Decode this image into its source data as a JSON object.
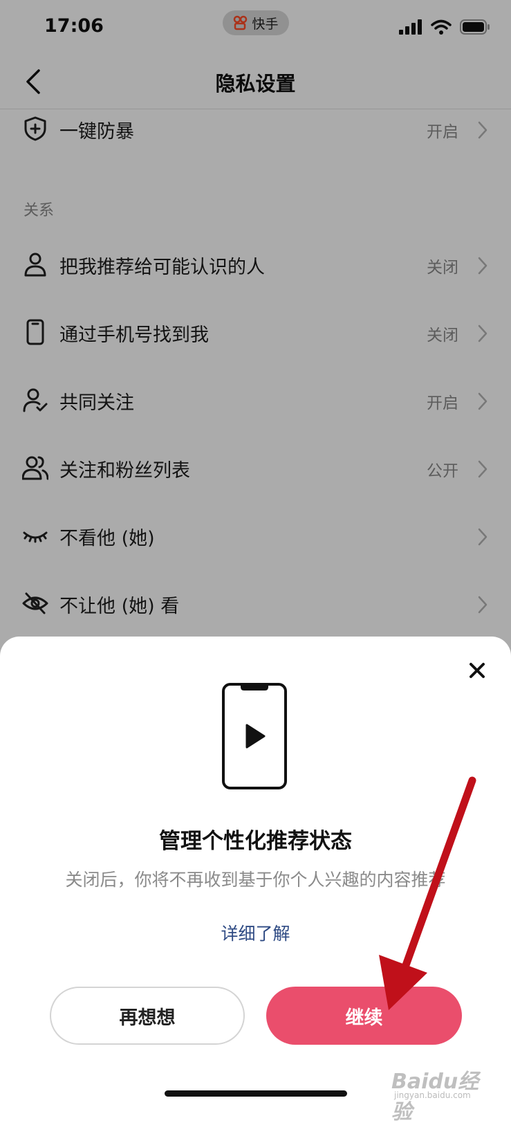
{
  "status_bar": {
    "time": "17:06",
    "app_pill_label": "快手"
  },
  "nav": {
    "title": "隐私设置"
  },
  "settings": {
    "top_row": {
      "label": "一键防暴",
      "value": "开启",
      "icon": "shield-plus-icon"
    },
    "section_header": "关系",
    "rows": [
      {
        "label": "把我推荐给可能认识的人",
        "value": "关闭",
        "icon": "person-icon"
      },
      {
        "label": "通过手机号找到我",
        "value": "关闭",
        "icon": "phone-icon"
      },
      {
        "label": "共同关注",
        "value": "开启",
        "icon": "person-check-icon"
      },
      {
        "label": "关注和粉丝列表",
        "value": "公开",
        "icon": "people-icon"
      },
      {
        "label": "不看他 (她)",
        "value": "",
        "icon": "closed-eye-icon"
      },
      {
        "label": "不让他 (她) 看",
        "value": "",
        "icon": "eye-slash-icon"
      }
    ]
  },
  "sheet": {
    "title": "管理个性化推荐状态",
    "description": "关闭后，你将不再收到基于你个人兴趣的内容推荐",
    "learn_more": "详细了解",
    "cancel_label": "再想想",
    "continue_label": "继续"
  },
  "watermark": {
    "main": "Baidu经验",
    "sub": "jingyan.baidu.com"
  },
  "colors": {
    "accent": "#ea4e6c",
    "link": "#2f4b84",
    "annotation_arrow": "#c0101a"
  }
}
